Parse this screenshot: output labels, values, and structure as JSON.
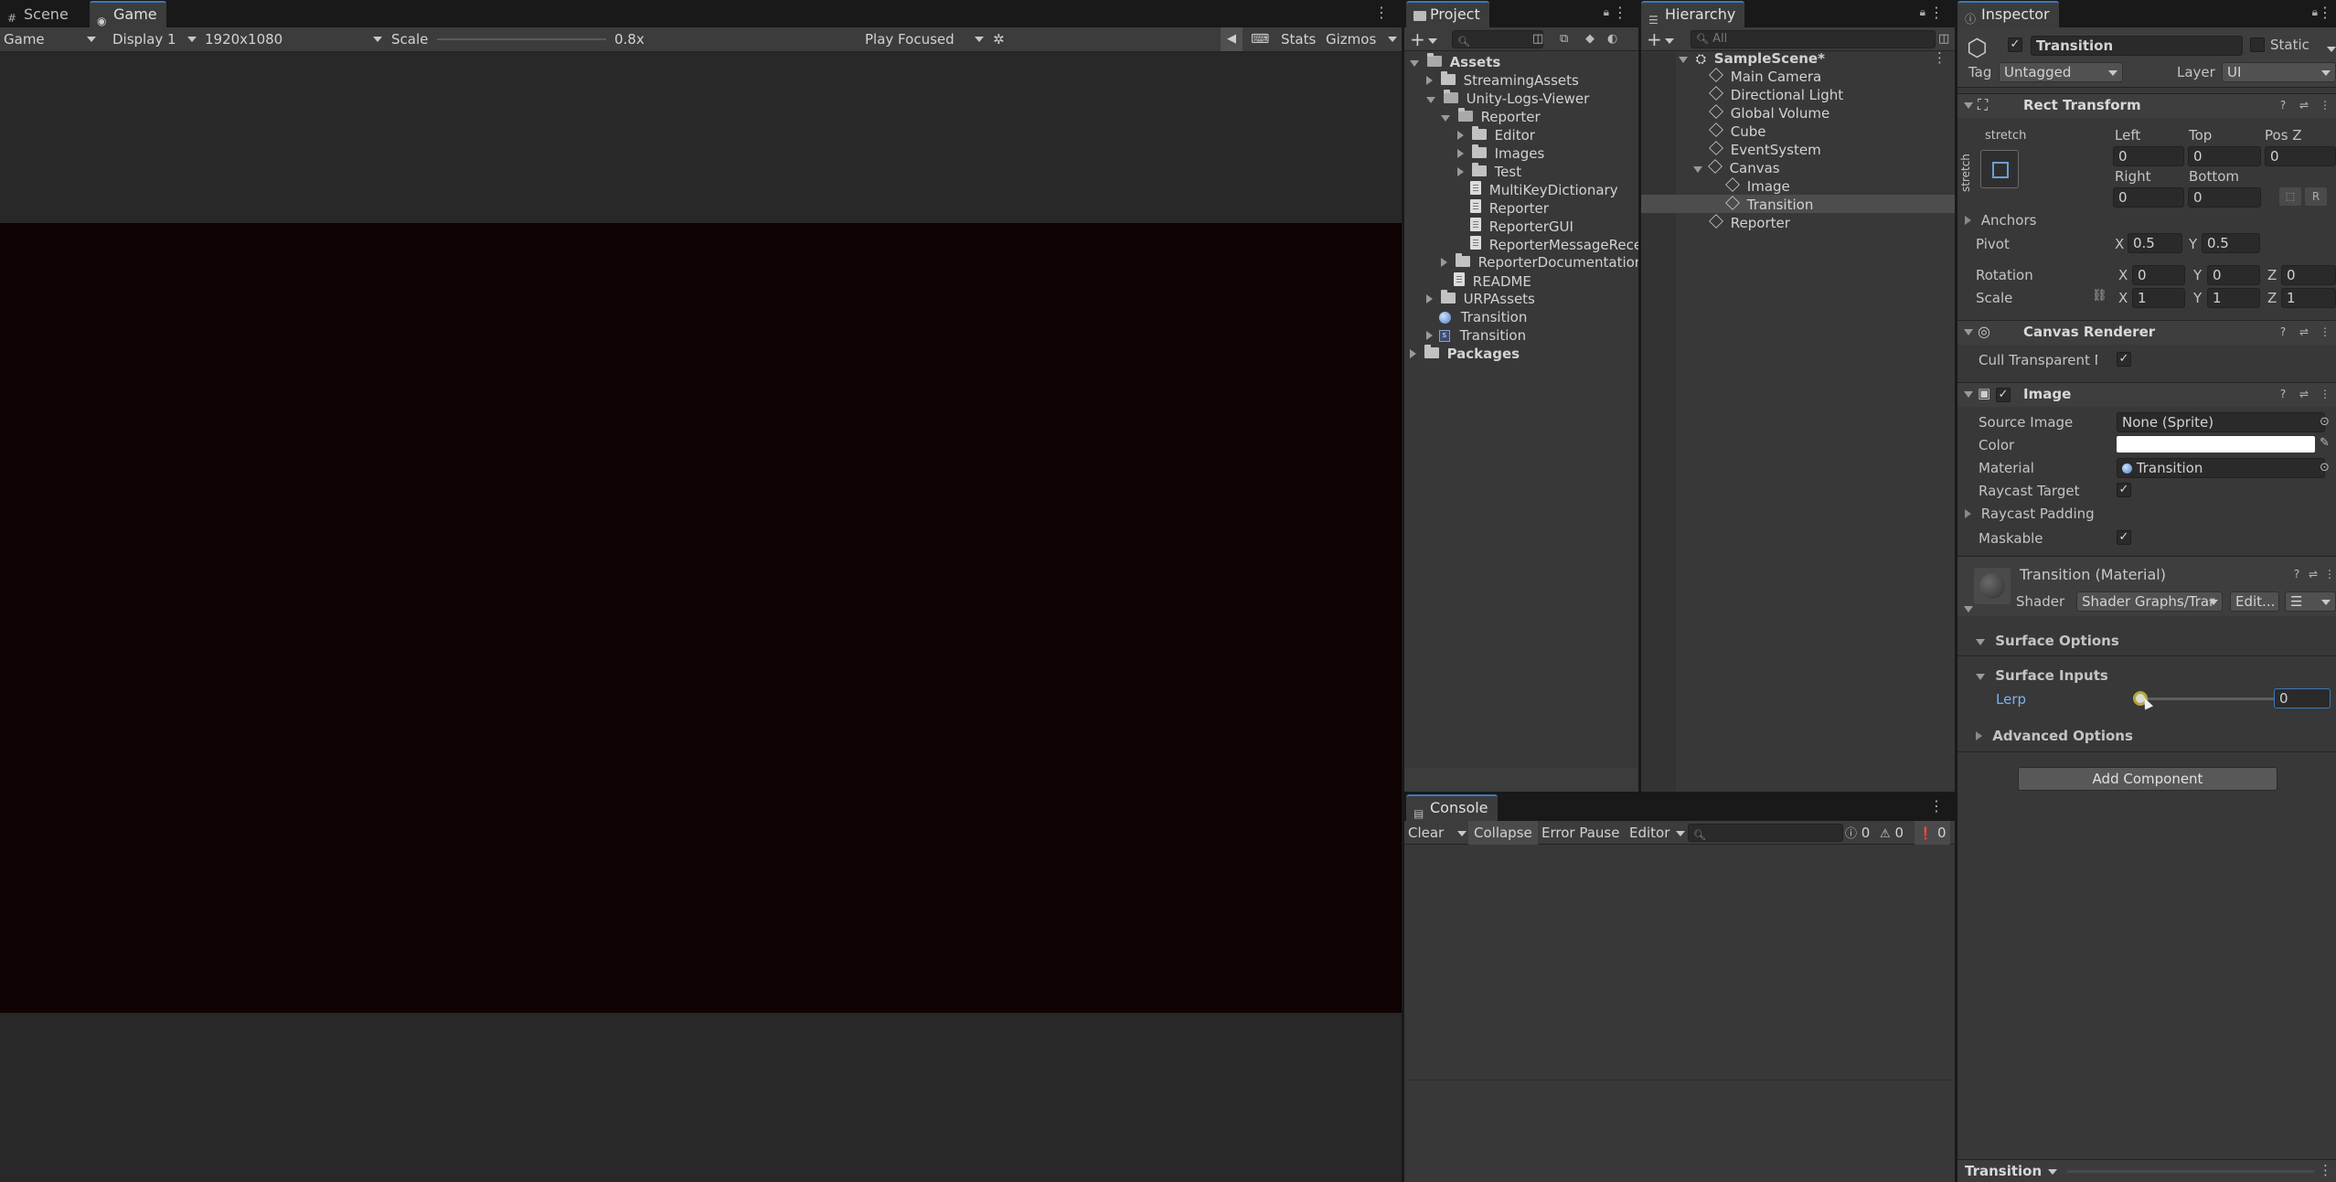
{
  "game_panel": {
    "tabs": [
      {
        "label": "Scene"
      },
      {
        "label": "Game"
      }
    ],
    "toolbar": {
      "view_mode": "Game",
      "display": "Display 1",
      "resolution": "1920x1080",
      "scale_label": "Scale",
      "scale_value": "0.8x",
      "play_mode": "Play Focused",
      "stats": "Stats",
      "gizmos": "Gizmos"
    },
    "viewport_color": "#0f0303"
  },
  "project_panel": {
    "tab": "Project",
    "tree": [
      {
        "label": "Assets",
        "kind": "folder"
      },
      {
        "label": "StreamingAssets",
        "kind": "folder"
      },
      {
        "label": "Unity-Logs-Viewer",
        "kind": "folder"
      },
      {
        "label": "Reporter",
        "kind": "folder"
      },
      {
        "label": "Editor",
        "kind": "folder"
      },
      {
        "label": "Images",
        "kind": "folder"
      },
      {
        "label": "Test",
        "kind": "folder"
      },
      {
        "label": "MultiKeyDictionary",
        "kind": "script"
      },
      {
        "label": "Reporter",
        "kind": "script"
      },
      {
        "label": "ReporterGUI",
        "kind": "script"
      },
      {
        "label": "ReporterMessageRece",
        "kind": "script"
      },
      {
        "label": "ReporterDocumentation",
        "kind": "folder"
      },
      {
        "label": "README",
        "kind": "text"
      },
      {
        "label": "URPAssets",
        "kind": "folder"
      },
      {
        "label": "Transition",
        "kind": "material"
      },
      {
        "label": "Transition",
        "kind": "shader"
      },
      {
        "label": "Packages",
        "kind": "folder"
      }
    ]
  },
  "hierarchy_panel": {
    "tab": "Hierarchy",
    "search_placeholder": "All",
    "scene": "SampleScene*",
    "items": [
      {
        "label": "Main Camera"
      },
      {
        "label": "Directional Light"
      },
      {
        "label": "Global Volume"
      },
      {
        "label": "Cube"
      },
      {
        "label": "EventSystem"
      },
      {
        "label": "Canvas"
      },
      {
        "label": "Image"
      },
      {
        "label": "Transition"
      },
      {
        "label": "Reporter"
      }
    ]
  },
  "console_panel": {
    "tab": "Console",
    "clear": "Clear",
    "collapse": "Collapse",
    "error_pause": "Error Pause",
    "editor": "Editor",
    "count_info": "0",
    "count_warn": "0",
    "count_error": "0"
  },
  "inspector": {
    "tab": "Inspector",
    "object_name": "Transition",
    "static_label": "Static",
    "tag_label": "Tag",
    "tag_value": "Untagged",
    "layer_label": "Layer",
    "layer_value": "UI",
    "rect_transform": {
      "title": "Rect Transform",
      "anchor_preset_label": "stretch",
      "left_label": "Left",
      "left": "0",
      "top_label": "Top",
      "top": "0",
      "posz_label": "Pos Z",
      "posz": "0",
      "right_label": "Right",
      "right": "0",
      "bottom_label": "Bottom",
      "bottom": "0",
      "anchors_label": "Anchors",
      "pivot_label": "Pivot",
      "pivot_x": "0.5",
      "pivot_y": "0.5",
      "rotation_label": "Rotation",
      "rot_x": "0",
      "rot_y": "0",
      "rot_z": "0",
      "scale_label": "Scale",
      "scale_x": "1",
      "scale_y": "1",
      "scale_z": "1",
      "btn_r": "R"
    },
    "canvas_renderer": {
      "title": "Canvas Renderer",
      "cull_label": "Cull Transparent Me"
    },
    "image": {
      "title": "Image",
      "source_label": "Source Image",
      "source_value": "None (Sprite)",
      "color_label": "Color",
      "color_value": "#ffffff",
      "material_label": "Material",
      "material_value": "Transition",
      "raycast_target_label": "Raycast Target",
      "raycast_padding_label": "Raycast Padding",
      "maskable_label": "Maskable"
    },
    "material": {
      "title": "Transition (Material)",
      "shader_label": "Shader",
      "shader_value": "Shader Graphs/Trar",
      "edit_button": "Edit...",
      "surface_options": "Surface Options",
      "surface_inputs": "Surface Inputs",
      "lerp_label": "Lerp",
      "lerp_value": "0",
      "advanced_options": "Advanced Options"
    },
    "add_component": "Add Component",
    "footer_label": "Transition"
  }
}
